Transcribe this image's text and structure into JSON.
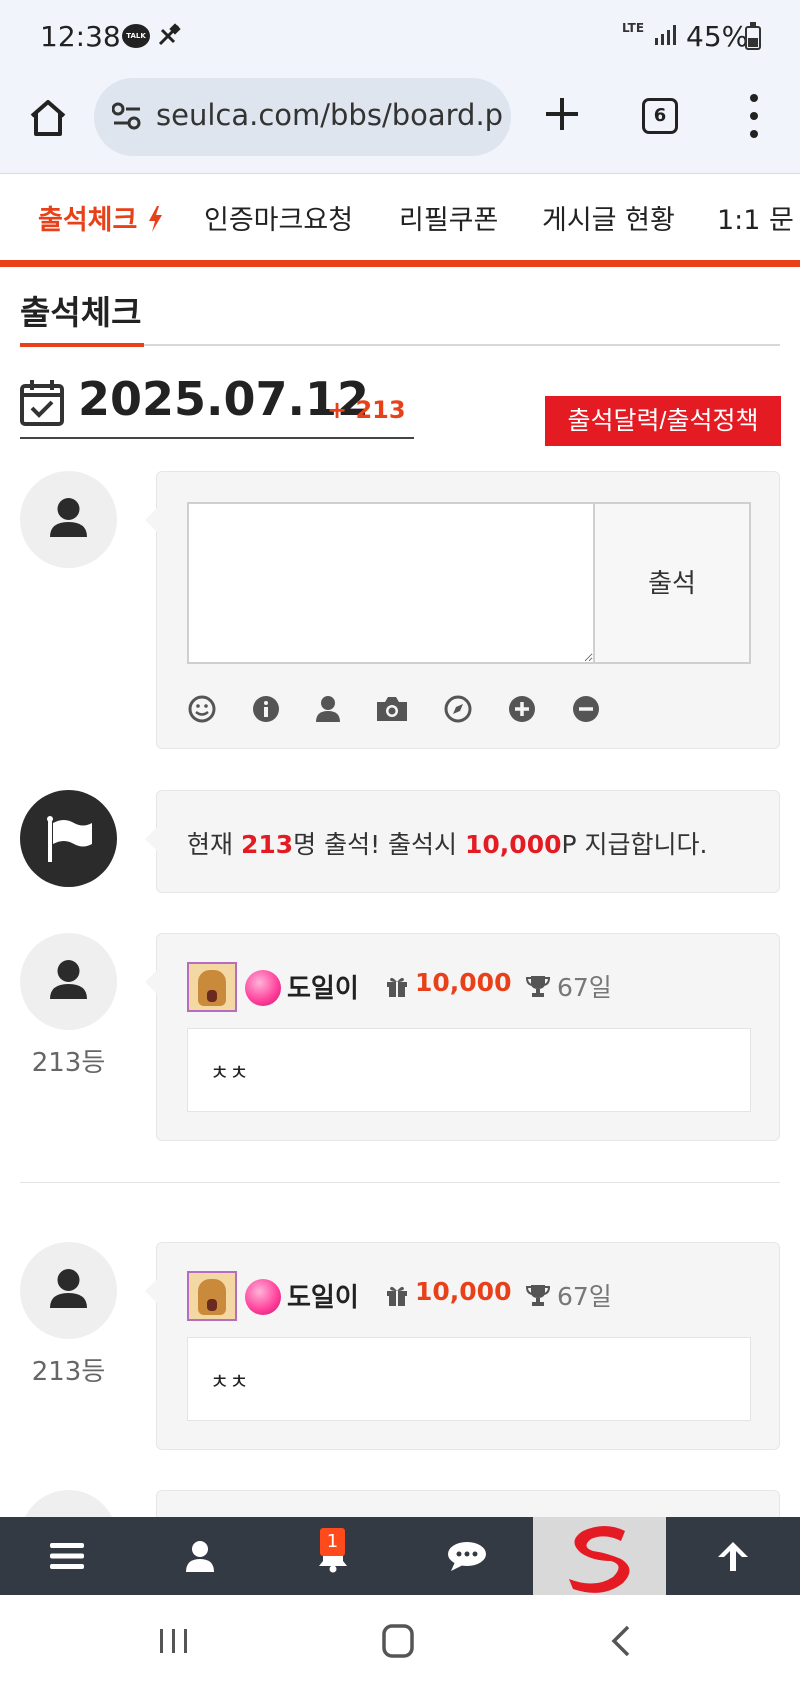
{
  "status_bar": {
    "time": "12:38",
    "talk_label": "TALK",
    "network": "LTE",
    "battery": "45%"
  },
  "browser": {
    "url": "seulca.com/bbs/board.p",
    "tab_count": "6"
  },
  "nav": {
    "tabs": [
      {
        "label": "출석체크"
      },
      {
        "label": "인증마크요청"
      },
      {
        "label": "리필쿠폰"
      },
      {
        "label": "게시글 현황"
      },
      {
        "label": "1:1 문"
      }
    ]
  },
  "page": {
    "title": "출석체크"
  },
  "date_row": {
    "date": "2025.07.12",
    "count": "+ 213",
    "policy_button": "출석달력/출석정책"
  },
  "attend_form": {
    "comment_value": "",
    "submit_label": "출석"
  },
  "notice": {
    "prefix": "현재 ",
    "count": "213",
    "middle": "명 출석! 출석시 ",
    "points": "10,000",
    "suffix": "P 지급합니다."
  },
  "entries": [
    {
      "rank": "213등",
      "name": "도일이",
      "points": "10,000",
      "days": "67일",
      "message": "ㅊㅊ"
    },
    {
      "rank": "213등",
      "name": "도일이",
      "points": "10,000",
      "days": "67일",
      "message": "ㅊㅊ"
    }
  ],
  "toolbar": {
    "notification_count": "1"
  },
  "colors": {
    "accent": "#e8411a",
    "button_red": "#e51b23",
    "toolbar": "#343a44"
  },
  "icons": [
    "home-icon",
    "site-settings-icon",
    "plus-icon",
    "more-vertical-icon",
    "calendar-check-icon",
    "user-icon",
    "flag-icon",
    "smile-icon",
    "info-icon",
    "camera-icon",
    "compass-icon",
    "plus-circle-icon",
    "minus-circle-icon",
    "gift-icon",
    "trophy-icon",
    "bars-icon",
    "bell-icon",
    "comment-icon",
    "arrow-up-icon"
  ]
}
